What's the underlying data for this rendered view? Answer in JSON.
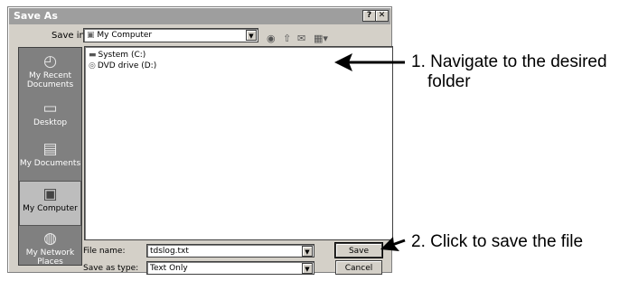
{
  "dialog": {
    "title": "Save As",
    "help_button": "?",
    "close_button": "✕",
    "save_in_label": "Save in:",
    "save_in_value": "My Computer",
    "toolbar_icons": [
      "back-icon",
      "up-folder-icon",
      "new-folder-icon",
      "views-menu-icon"
    ]
  },
  "places": [
    {
      "label": "My Recent Documents",
      "icon": "recent-documents-icon"
    },
    {
      "label": "Desktop",
      "icon": "desktop-icon"
    },
    {
      "label": "My Documents",
      "icon": "my-documents-icon"
    },
    {
      "label": "My Computer",
      "icon": "my-computer-icon",
      "selected": true
    },
    {
      "label": "My Network Places",
      "icon": "network-places-icon"
    }
  ],
  "files": [
    {
      "label": "System (C:)",
      "icon": "hard-drive-icon"
    },
    {
      "label": "DVD drive (D:)",
      "icon": "dvd-drive-icon"
    }
  ],
  "form": {
    "file_name_label": "File name:",
    "file_name_value": "tdslog.txt",
    "save_as_type_label": "Save as type:",
    "save_as_type_value": "Text Only",
    "save_button": "Save",
    "cancel_button": "Cancel"
  },
  "annotations": {
    "step1_line1": "1. Navigate to the desired",
    "step1_line2": "folder",
    "step2": "2. Click to save the file"
  }
}
